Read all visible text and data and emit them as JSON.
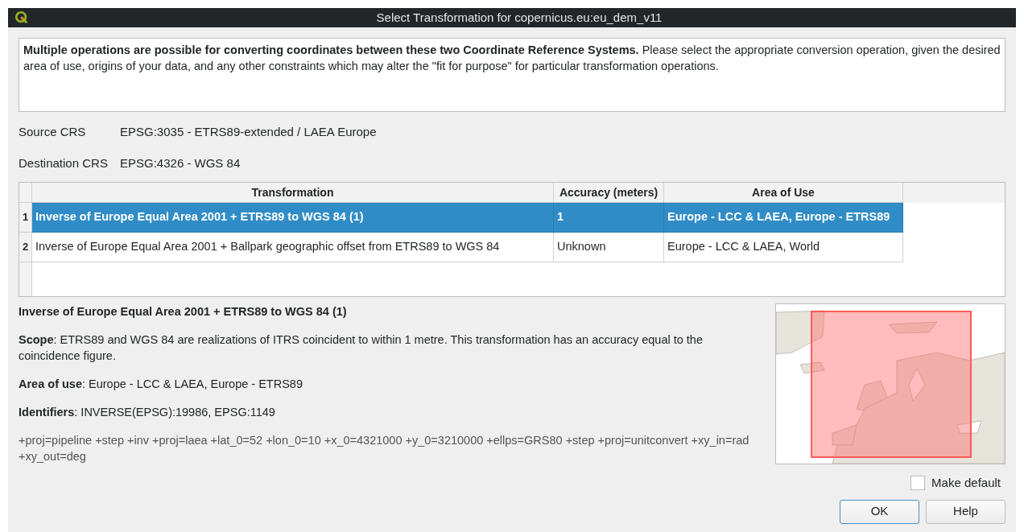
{
  "window": {
    "title": "Select Transformation for copernicus.eu:eu_dem_v11"
  },
  "intro": "**Multiple operations are possible for converting coordinates between these two Coordinate Reference Systems.** Please select the appropriate conversion operation, given the desired area of use, origins of your data, and any other constraints which may alter the \"fit for purpose\" for particular transformation operations.",
  "crs": [
    {
      "label": "Source CRS",
      "value": "EPSG:3035 - ETRS89-extended / LAEA Europe"
    },
    {
      "label": "Destination CRS",
      "value": "EPSG:4326 - WGS 84"
    }
  ],
  "table": {
    "columns": [
      "Transformation",
      "Accuracy (meters)",
      "Area of Use"
    ],
    "rows": [
      {
        "number": "1",
        "cells": [
          "Inverse of Europe Equal Area 2001 + ETRS89 to WGS 84 (1)",
          "1",
          "Europe - LCC & LAEA, Europe - ETRS89"
        ],
        "selected": true
      },
      {
        "number": "2",
        "cells": [
          "Inverse of Europe Equal Area 2001 + Ballpark geographic offset from ETRS89 to WGS 84",
          "Unknown",
          "Europe - LCC & LAEA, World"
        ],
        "selected": false
      }
    ]
  },
  "details": {
    "title": "Inverse of Europe Equal Area 2001 + ETRS89 to WGS 84 (1)",
    "paragraphs": [
      "**Scope**: ETRS89 and WGS 84 are realizations of ITRS coincident to within 1 metre. This transformation has an accuracy equal to the coincidence figure.",
      "**Area of use**: Europe - LCC & LAEA, Europe - ETRS89",
      "**Identifiers**: INVERSE(EPSG):19986, EPSG:1149"
    ],
    "proj": "+proj=pipeline +step +inv +proj=laea +lat_0=52 +lon_0=10 +x_0=4321000 +y_0=3210000 +ellps=GRS80 +step +proj=unitconvert +xy_in=rad +xy_out=deg"
  },
  "make_default": {
    "label": "Make default",
    "checked": false
  },
  "buttons": [
    "OK",
    "Help"
  ]
}
